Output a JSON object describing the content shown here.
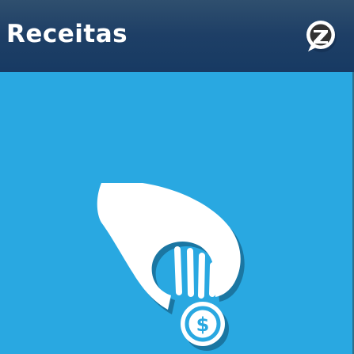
{
  "header": {
    "title": "Receitas",
    "background_color": "#1e3f66",
    "logo_icon": "chat-bubble-logo-icon"
  },
  "content": {
    "background_color": "#29a8e1",
    "illustration_icon": "hand-dropping-coin-icon",
    "coin_symbol": "$"
  }
}
